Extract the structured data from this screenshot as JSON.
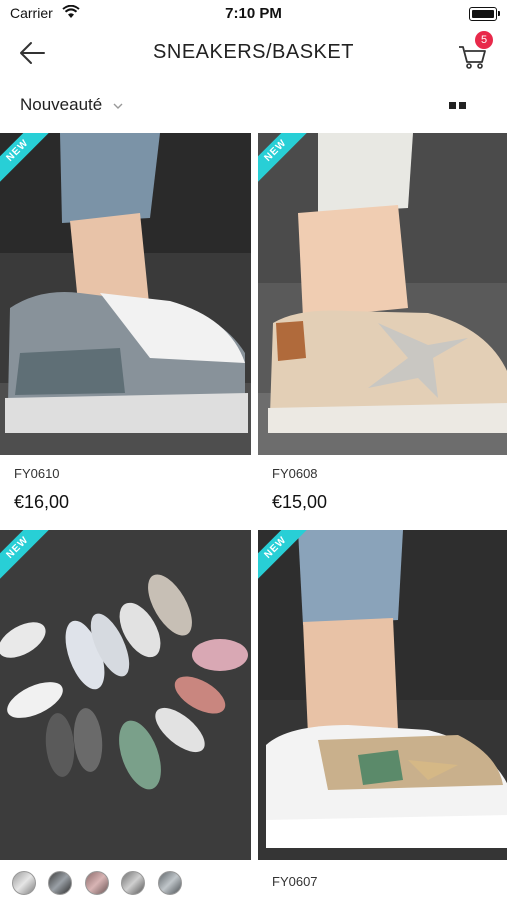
{
  "status_bar": {
    "carrier": "Carrier",
    "time": "7:10 PM"
  },
  "nav": {
    "title": "SNEAKERS/BASKET",
    "cart_count": "5"
  },
  "filter": {
    "sort_label": "Nouveauté"
  },
  "products": [
    {
      "sku": "FY0610",
      "price": "€16,00",
      "ribbon": "NEW"
    },
    {
      "sku": "FY0608",
      "price": "€15,00",
      "ribbon": "NEW"
    },
    {
      "sku": "",
      "price": "",
      "ribbon": "NEW"
    },
    {
      "sku": "FY0607",
      "price": "",
      "ribbon": "NEW"
    }
  ],
  "colors": {
    "accent": "#28cfd6",
    "badge": "#e8294a"
  }
}
